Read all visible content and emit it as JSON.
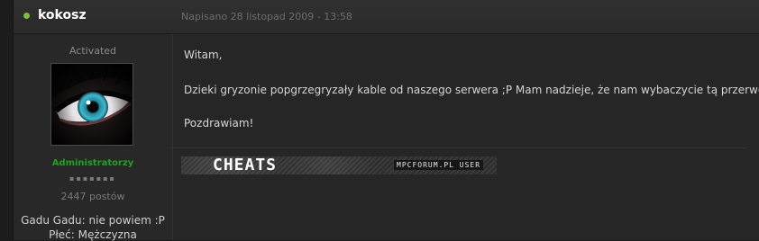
{
  "post": {
    "author": "kokosz",
    "date": "Napisano 28 listopad 2009 - 13:58"
  },
  "author_panel": {
    "member_title": "Activated",
    "group": "Administratorzy",
    "pips": "▪▪▪▪▪▪▪",
    "post_count": "2447 postów",
    "fields": [
      "Gadu Gadu: nie powiem :P",
      "Płeć: Mężczyzna"
    ]
  },
  "body": {
    "lines": [
      "Witam,",
      "Dzieki gryzonie popgrzegryzały kable od naszego serwera ;P Mam nadzieje, że nam wybaczycie tą przerwę!",
      "Pozdrawiam!"
    ]
  },
  "signature": {
    "banner_text": "CHEATS",
    "banner_small": "MPCFORUM.PL USER"
  },
  "colors": {
    "online": "#7bbf3a",
    "group": "#1fa21f"
  }
}
